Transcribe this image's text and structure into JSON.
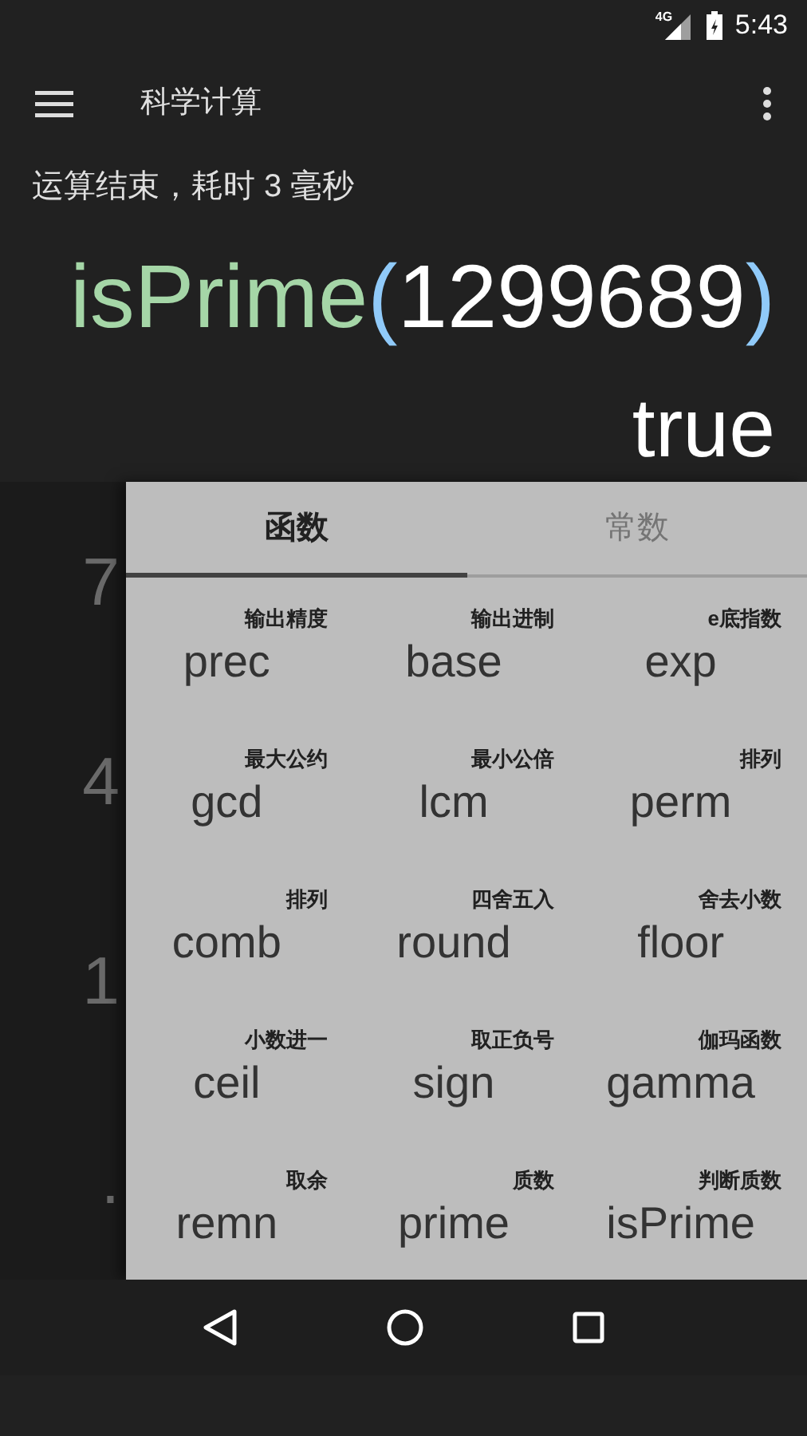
{
  "status_bar": {
    "network": "4G",
    "time": "5:43"
  },
  "toolbar": {
    "title": "科学计算"
  },
  "message": "运算结束，耗时 3 毫秒",
  "expression": [
    {
      "text": "isPrime",
      "color": "#a5d6a7"
    },
    {
      "text": "(",
      "color": "#90caf9"
    },
    {
      "text": "1299689",
      "color": "#ffffff"
    },
    {
      "text": ")",
      "color": "#90caf9"
    }
  ],
  "result": "true",
  "digit_keys": [
    "7",
    "4",
    "1",
    "."
  ],
  "tabs": [
    {
      "label": "函数",
      "selected": true
    },
    {
      "label": "常数",
      "selected": false
    }
  ],
  "functions": [
    {
      "hint": "输出精度",
      "name": "prec"
    },
    {
      "hint": "输出进制",
      "name": "base"
    },
    {
      "hint": "e底指数",
      "name": "exp"
    },
    {
      "hint": "最大公约",
      "name": "gcd"
    },
    {
      "hint": "最小公倍",
      "name": "lcm"
    },
    {
      "hint": "排列",
      "name": "perm"
    },
    {
      "hint": "排列",
      "name": "comb"
    },
    {
      "hint": "四舍五入",
      "name": "round"
    },
    {
      "hint": "舍去小数",
      "name": "floor"
    },
    {
      "hint": "小数进一",
      "name": "ceil"
    },
    {
      "hint": "取正负号",
      "name": "sign"
    },
    {
      "hint": "伽玛函数",
      "name": "gamma"
    },
    {
      "hint": "取余",
      "name": "remn"
    },
    {
      "hint": "质数",
      "name": "prime"
    },
    {
      "hint": "判断质数",
      "name": "isPrime"
    }
  ]
}
